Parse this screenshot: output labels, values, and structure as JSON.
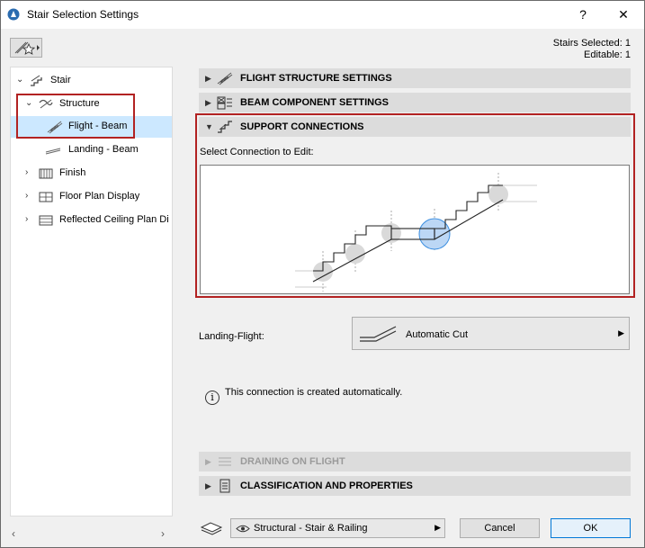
{
  "window": {
    "title": "Stair Selection Settings",
    "help_label": "?",
    "close_label": "✕"
  },
  "status": {
    "stairs_selected": "Stairs Selected: 1",
    "editable": "Editable: 1"
  },
  "tree": {
    "items": [
      {
        "label": "Stair"
      },
      {
        "label": "Structure"
      },
      {
        "label": "Flight - Beam"
      },
      {
        "label": "Landing - Beam"
      },
      {
        "label": "Finish"
      },
      {
        "label": "Floor Plan Display"
      },
      {
        "label": "Reflected Ceiling Plan Di"
      }
    ]
  },
  "sections": {
    "flight_structure": "FLIGHT STRUCTURE SETTINGS",
    "beam_component": "BEAM COMPONENT SETTINGS",
    "support_connections": "SUPPORT CONNECTIONS",
    "draining": "DRAINING ON FLIGHT",
    "classification": "CLASSIFICATION AND PROPERTIES"
  },
  "support": {
    "select_label": "Select Connection to Edit:",
    "landing_flight_label": "Landing-Flight:",
    "landing_flight_value": "Automatic Cut",
    "info_text": "This connection is created automatically."
  },
  "footer": {
    "profile_value": "Structural - Stair & Railing",
    "cancel_label": "Cancel",
    "ok_label": "OK"
  },
  "colors": {
    "selection_bg": "#cce8ff",
    "highlight_red": "#b22222",
    "ok_border": "#0078d7"
  }
}
